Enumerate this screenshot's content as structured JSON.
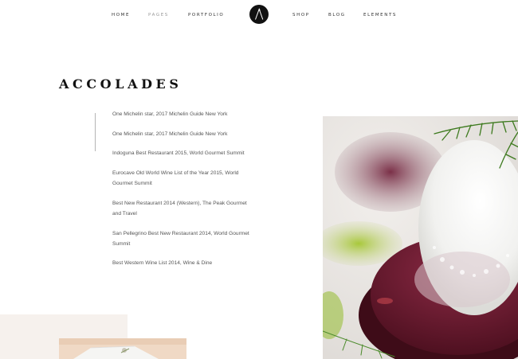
{
  "nav": {
    "left": [
      "HOME",
      "PAGES",
      "PORTFOLIO"
    ],
    "right": [
      "SHOP",
      "BLOG",
      "ELEMENTS"
    ],
    "logo_icon": "letter-a-logo-icon",
    "active_color": "#9a9a9a"
  },
  "section": {
    "title": "ACCOLADES"
  },
  "accolades": [
    "One Michelin star, 2017 Michelin Guide New York",
    "One Michelin star, 2017 Michelin Guide New York",
    "Indoguna Best Restaurant 2015, World Gourmet Summit",
    "Eurocave Old World Wine List of the Year 2015, World Gourmet Summit",
    "Best New Restaurant 2014 (Western), The Peak Gourmet and Travel",
    "San Pellegrino Best New Restaurant 2014, World Gourmet Summit",
    "Best Western Wine List 2014, Wine & Dine"
  ],
  "colors": {
    "accent_block": "#f6f1ed",
    "dish_red": "#7a1f35"
  }
}
